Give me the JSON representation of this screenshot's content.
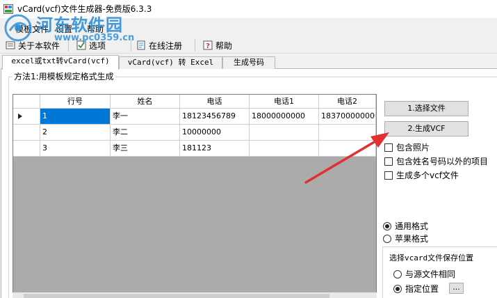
{
  "window": {
    "title": "vCard(vcf)文件生成器-免费版6.3.3"
  },
  "watermark": {
    "title": "河东软件园",
    "url": "www.pc0359.cn"
  },
  "menu": [
    "模板文件",
    "设置",
    "帮助"
  ],
  "toolbar": {
    "about": "关于本软件",
    "options": "选项",
    "register": "在线注册",
    "help": "帮助"
  },
  "tabs": [
    "excel或txt转vCard(vcf)",
    "vCard(vcf) 转 Excel",
    "生成号码"
  ],
  "method_label": "方法1:用模板规定格式生成",
  "grid": {
    "columns": [
      "行号",
      "姓名",
      "电话",
      "电话1",
      "电话2"
    ],
    "rows": [
      [
        "1",
        "李一",
        "18123456789",
        "18000000000",
        "183700000000"
      ],
      [
        "2",
        "李二",
        "10000000",
        "",
        ""
      ],
      [
        "3",
        "李三",
        "181123",
        "",
        ""
      ]
    ],
    "selected_row": 0
  },
  "buttons": {
    "choose_file": "1.选择文件",
    "generate_vcf": "2.生成VCF"
  },
  "options": {
    "include_photo": "包含照片",
    "include_other": "包含姓名号码以外的项目",
    "multiple_files": "生成多个vcf文件"
  },
  "format": {
    "general": "通用格式",
    "apple": "苹果格式",
    "selected": "general"
  },
  "save_location": {
    "title": "选择vcard文件保存位置",
    "same_as_source": "与源文件相同",
    "specified": "指定位置",
    "browse": "...",
    "selected": "specified"
  },
  "colors": {
    "selection": "#0078d7",
    "arrow": "#e03030",
    "watermark": "#2f8fd8"
  }
}
